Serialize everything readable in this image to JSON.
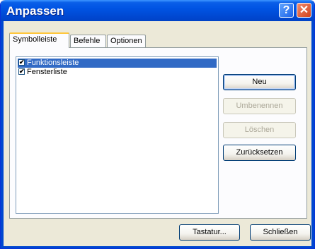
{
  "window": {
    "title": "Anpassen",
    "help_glyph": "?",
    "close_glyph": "✕"
  },
  "tabs": [
    {
      "label": "Symbolleiste",
      "active": true
    },
    {
      "label": "Befehle",
      "active": false
    },
    {
      "label": "Optionen",
      "active": false
    }
  ],
  "toolbar_list": {
    "items": [
      {
        "label": "Funktionsleiste",
        "checked": true,
        "selected": true
      },
      {
        "label": "Fensterliste",
        "checked": true,
        "selected": false
      }
    ]
  },
  "side_buttons": {
    "new_label": "Neu",
    "rename_label": "Umbenennen",
    "delete_label": "Löschen",
    "reset_label": "Zurücksetzen"
  },
  "footer": {
    "keyboard_label": "Tastatur...",
    "close_label": "Schließen"
  },
  "check_glyph": "✔",
  "colors": {
    "titlebar": "#0054e3",
    "selection": "#316ac5",
    "dialog_bg": "#ece9d8"
  }
}
